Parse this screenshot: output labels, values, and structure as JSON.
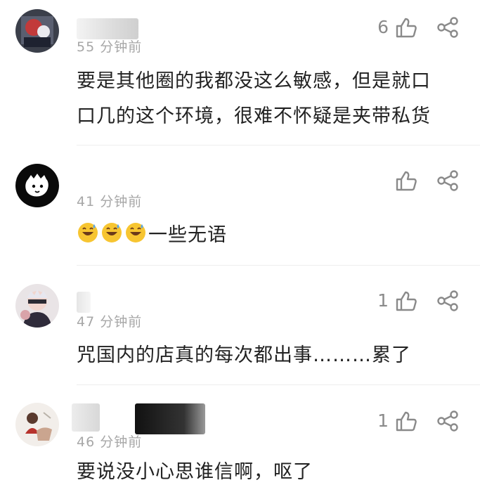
{
  "comments": [
    {
      "username": "",
      "time": "55 分钟前",
      "likes": "6",
      "lines": [
        "要是其他圈的我都没这么敏感，但是就口",
        "口几的这个环境，很难不怀疑是夹带私货"
      ]
    },
    {
      "username": "",
      "time": "41 分钟前",
      "likes": "",
      "emoji_count": 3,
      "lines": [
        "一些无语"
      ]
    },
    {
      "username": "",
      "time": "47 分钟前",
      "likes": "1",
      "lines": [
        "咒国内的店真的每次都出事………累了"
      ]
    },
    {
      "username": "",
      "time": "46 分钟前",
      "likes": "1",
      "lines": [
        "要说没小心思谁信啊，呕了"
      ]
    }
  ],
  "icons": {
    "like": "thumbs-up-outline-icon",
    "share": "share-nodes-icon",
    "emoji": "grinning-sweat-emoji-icon"
  },
  "colors": {
    "text": "#222222",
    "meta": "#a7a7a7",
    "icon": "#8a8a8a",
    "divider": "#eeeeee"
  }
}
